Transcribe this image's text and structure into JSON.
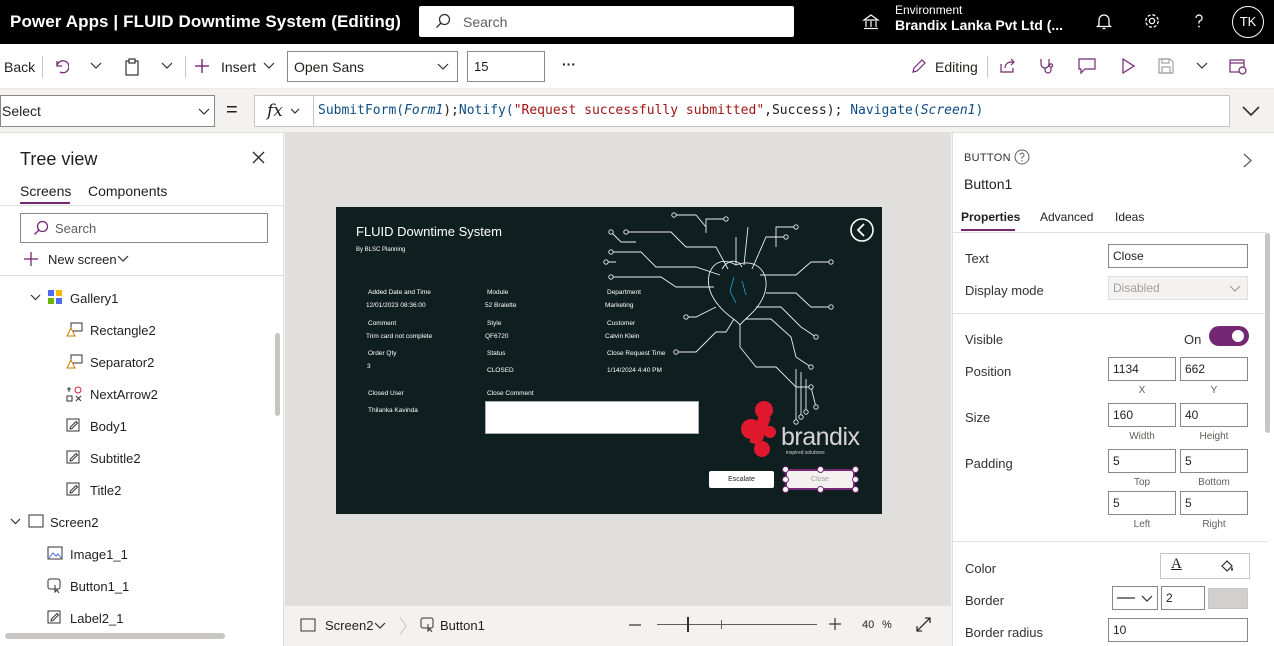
{
  "topbar": {
    "app_title": "Power Apps  |  FLUID Downtime System (Editing)",
    "search_placeholder": "Search",
    "environment_label": "Environment",
    "environment_value": "Brandix Lanka Pvt Ltd (...",
    "avatar_initials": "TK"
  },
  "toolbar": {
    "back": "Back",
    "insert": "Insert",
    "font": "Open Sans",
    "font_size": "15",
    "more": "···",
    "editing": "Editing"
  },
  "formula_bar": {
    "property": "Select",
    "equals": "=",
    "fx": "fx",
    "formula_parts": [
      "SubmitForm(",
      "Form1",
      ");",
      "Notify(",
      "\"Request successfully submitted\"",
      ",Success); ",
      "Navigate(",
      "Screen1",
      ")"
    ]
  },
  "tree": {
    "title": "Tree view",
    "tab_screens": "Screens",
    "tab_components": "Components",
    "search_placeholder": "Search",
    "new_screen": "New screen",
    "items": [
      {
        "label": "Gallery1"
      },
      {
        "label": "Rectangle2"
      },
      {
        "label": "Separator2"
      },
      {
        "label": "NextArrow2"
      },
      {
        "label": "Body1"
      },
      {
        "label": "Subtitle2"
      },
      {
        "label": "Title2"
      },
      {
        "label": "Screen2"
      },
      {
        "label": "Image1_1"
      },
      {
        "label": "Button1_1"
      },
      {
        "label": "Label2_1"
      }
    ]
  },
  "app_preview": {
    "title": "FLUID Downtime System",
    "subtitle": "By BLSC Planning",
    "fields": {
      "added_label": "Added Date and Time",
      "added_value": "12/01/2023 08:36:00",
      "module_label": "Module",
      "module_value": "52 Bralette",
      "department_label": "Department",
      "department_value": "Marketing",
      "comment_label": "Comment",
      "comment_value": "Trim card not complete",
      "style_label": "Style",
      "style_value": "QF6720",
      "customer_label": "Customer",
      "customer_value": "Calvin Klein",
      "orderqty_label": "Order Qty",
      "orderqty_value": "3",
      "status_label": "Status",
      "status_value": "CLOSED",
      "closereq_label": "Close Request Time",
      "closereq_value": "1/14/2024 4:40 PM",
      "closeduser_label": "Closed User",
      "closeduser_value": "Thilanka Kavinda",
      "closecomment_label": "Close Comment"
    },
    "escalate": "Escalate",
    "close": "Close",
    "brand_name": "brandix",
    "brand_tagline": "inspired solutions",
    "brand_color": "#e0182d"
  },
  "bottombar": {
    "screen": "Screen2",
    "control": "Button1",
    "zoom_value": "40",
    "zoom_unit": "%"
  },
  "props": {
    "control_type": "BUTTON",
    "control_name": "Button1",
    "tab_properties": "Properties",
    "tab_advanced": "Advanced",
    "tab_ideas": "Ideas",
    "text_label": "Text",
    "text_value": "Close",
    "display_mode_label": "Display mode",
    "display_mode_value": "Disabled",
    "visible_label": "Visible",
    "visible_value": "On",
    "position_label": "Position",
    "position_x": "1134",
    "position_y": "662",
    "x_label": "X",
    "y_label": "Y",
    "size_label": "Size",
    "size_w": "160",
    "size_h": "40",
    "width_label": "Width",
    "height_label": "Height",
    "padding_label": "Padding",
    "pad_top": "5",
    "pad_bottom": "5",
    "pad_left": "5",
    "pad_right": "5",
    "top_label": "Top",
    "bottom_label": "Bottom",
    "left_label": "Left",
    "right_label": "Right",
    "color_label": "Color",
    "color_glyph": "A",
    "border_label": "Border",
    "border_width": "2",
    "border_radius_label": "Border radius",
    "border_radius_value": "10",
    "accent": "#742774"
  }
}
